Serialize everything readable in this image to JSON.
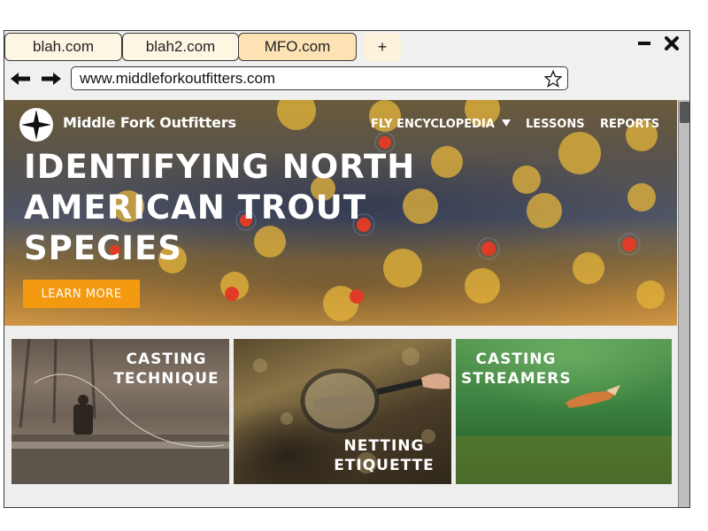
{
  "browser": {
    "tabs": [
      {
        "label": "blah.com",
        "active": false
      },
      {
        "label": "blah2.com",
        "active": false
      },
      {
        "label": "MFO.com",
        "active": true
      }
    ],
    "new_tab_label": "+",
    "url": "www.middleforkoutfitters.com",
    "icons": {
      "back": "back-arrow-icon",
      "forward": "forward-arrow-icon",
      "bookmark": "star-icon",
      "minimize": "minimize-icon",
      "close": "close-icon"
    }
  },
  "site": {
    "brand": "Middle Fork Outfitters",
    "nav": [
      {
        "label": "FLY ENCYCLOPEDIA",
        "has_dropdown": true
      },
      {
        "label": "LESSONS",
        "has_dropdown": false
      },
      {
        "label": "REPORTS",
        "has_dropdown": false
      }
    ],
    "hero": {
      "title": "IDENTIFYING NORTH\nAMERICAN TROUT\nSPECIES",
      "cta": "LEARN MORE"
    },
    "cards": [
      {
        "title": "CASTING\nTECHNIQUE"
      },
      {
        "title": "NETTING\nETIQUETTE"
      },
      {
        "title": "CASTING\nSTREAMERS"
      }
    ]
  },
  "colors": {
    "accent": "#f39a10",
    "active_tab": "#fde2b4",
    "tab": "#fdf6e3"
  }
}
